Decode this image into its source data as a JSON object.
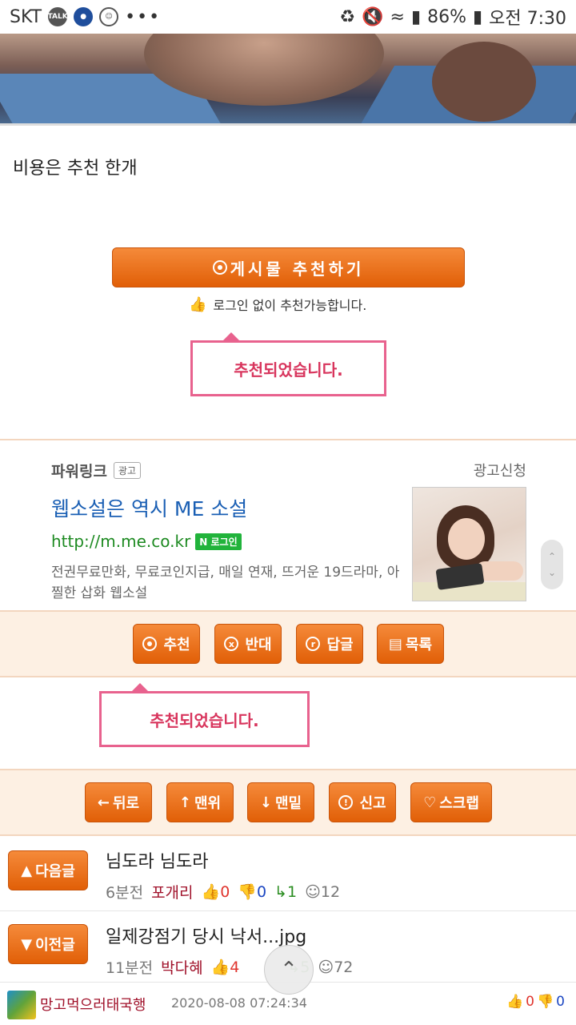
{
  "status_bar": {
    "carrier": "SKT",
    "talk_label": "TALK",
    "battery": "86%",
    "time": "오전 7:30",
    "dots": "•••"
  },
  "post": {
    "body_text": "비용은 추천 한개",
    "recommend_button": "게시물 추천하기",
    "login_note": "로그인 없이 추천가능합니다.",
    "tooltip_text": "추천되었습니다."
  },
  "ad": {
    "header": "파워링크",
    "badge": "광고",
    "apply": "광고신청",
    "title": "웹소설은 역시 ME 소설",
    "url": "http://m.me.co.kr",
    "login_badge": "로그인",
    "description": "전권무료만화, 무료코인지급, 매일 연재, 뜨거운 19드라마, 아찔한 삽화 웹소설"
  },
  "action_bar": {
    "recommend": "추천",
    "oppose": "반대",
    "reply": "답글",
    "list": "목록",
    "tooltip_text": "추천되었습니다."
  },
  "nav_bar": {
    "back": "뒤로",
    "top": "맨위",
    "bottom": "맨밑",
    "report": "신고",
    "scrap": "스크랩"
  },
  "next_post": {
    "button": "다음글",
    "title": "님도라 님도라",
    "time": "6분전",
    "author": "포개리",
    "up": "0",
    "down": "0",
    "replies": "1",
    "views": "12"
  },
  "prev_post": {
    "button": "이전글",
    "title": "일제강점기 당시 낙서...jpg",
    "time": "11분전",
    "author": "박다혜",
    "up": "4",
    "replies": "5",
    "views": "72"
  },
  "footer": {
    "name": "망고먹으러태국행",
    "date": "2020-08-08 07:24:34",
    "up": "0",
    "down": "0"
  },
  "colors": {
    "accent_orange": "#e8620a",
    "tooltip_pink": "#e8628e",
    "link_blue": "#1a5fb4",
    "url_green": "#1d8a21"
  }
}
